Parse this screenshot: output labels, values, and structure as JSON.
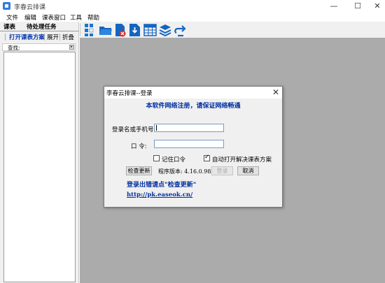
{
  "window": {
    "title": "李春云排课",
    "minimize": "—",
    "maximize": "☐",
    "close": "✕"
  },
  "menu": [
    "文件",
    "编辑",
    "课表窗口",
    "工具",
    "帮助"
  ],
  "left_panel": {
    "tabs": [
      "课表",
      "待处理任务"
    ],
    "actions": {
      "open": "打开课表方案",
      "expand": "展开",
      "collapse": "折叠"
    },
    "search_label": "查找:"
  },
  "toolbar_icons": [
    "grid-select-icon",
    "open-folder-icon",
    "delete-file-icon",
    "download-icon",
    "table-icon",
    "layers-icon",
    "export-icon"
  ],
  "colors": {
    "accent_blue": "#002fa0",
    "workspace_gray": "#ababab",
    "icon_blue": "#1565c0"
  },
  "dialog": {
    "title": "李春云排课--登录",
    "notice": "本软件网络注册，请保证网络畅通",
    "username_label": "登录名或手机号:",
    "username_value": "",
    "password_label": "口    令:",
    "password_value": "",
    "remember_label": "记住口令",
    "remember_checked": false,
    "auto_open_label": "自动打开解决课表方案",
    "auto_open_checked": true,
    "check_update": "检查更新",
    "version": "程序版本: 4.16.0.98",
    "login": "登录",
    "cancel": "取消",
    "error_hint": "登录出错请点\"检查更新\"",
    "url": "http://pk.easeok.cn/"
  }
}
